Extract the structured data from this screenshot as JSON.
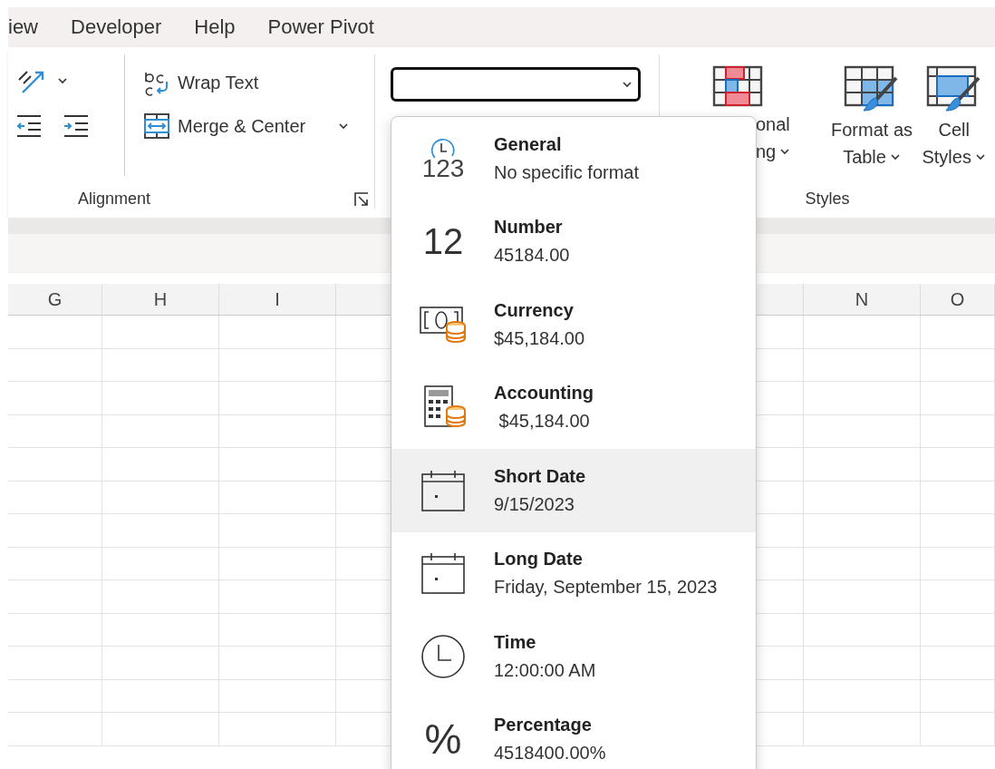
{
  "menu_tabs": [
    {
      "label": "iew"
    },
    {
      "label": "Developer"
    },
    {
      "label": "Help"
    },
    {
      "label": "Power Pivot"
    }
  ],
  "alignment": {
    "wrap_text": "Wrap Text",
    "merge_center": "Merge & Center",
    "group_label": "Alignment"
  },
  "styles": {
    "buttons": [
      {
        "kind": "conditional",
        "lines": [
          "onal",
          "ng"
        ]
      },
      {
        "kind": "table",
        "lines": [
          "Format as",
          "Table"
        ]
      },
      {
        "kind": "cell",
        "lines": [
          "Cell",
          "Styles"
        ]
      }
    ],
    "group_label": "Styles"
  },
  "sheet": {
    "left_columns": [
      "G",
      "H",
      "I"
    ],
    "right_columns": [
      "N",
      "O"
    ]
  },
  "format_menu": [
    {
      "kind": "general",
      "icon_text": "123",
      "name": "General",
      "example": "No specific format",
      "selected": false
    },
    {
      "kind": "number",
      "icon_text": "12",
      "name": "Number",
      "example": "45184.00",
      "selected": false
    },
    {
      "kind": "currency",
      "name": "Currency",
      "example": "$45,184.00",
      "selected": false
    },
    {
      "kind": "accounting",
      "name": "Accounting",
      "example": " $45,184.00",
      "selected": false
    },
    {
      "kind": "date",
      "name": "Short Date",
      "example": "9/15/2023",
      "selected": true
    },
    {
      "kind": "date",
      "name": "Long Date",
      "example": "Friday, September 15, 2023",
      "selected": false
    },
    {
      "kind": "time",
      "name": "Time",
      "example": "12:00:00 AM",
      "selected": false
    },
    {
      "kind": "percent",
      "icon_text": "%",
      "name": "Percentage",
      "example": "4518400.00%",
      "selected": false
    }
  ]
}
